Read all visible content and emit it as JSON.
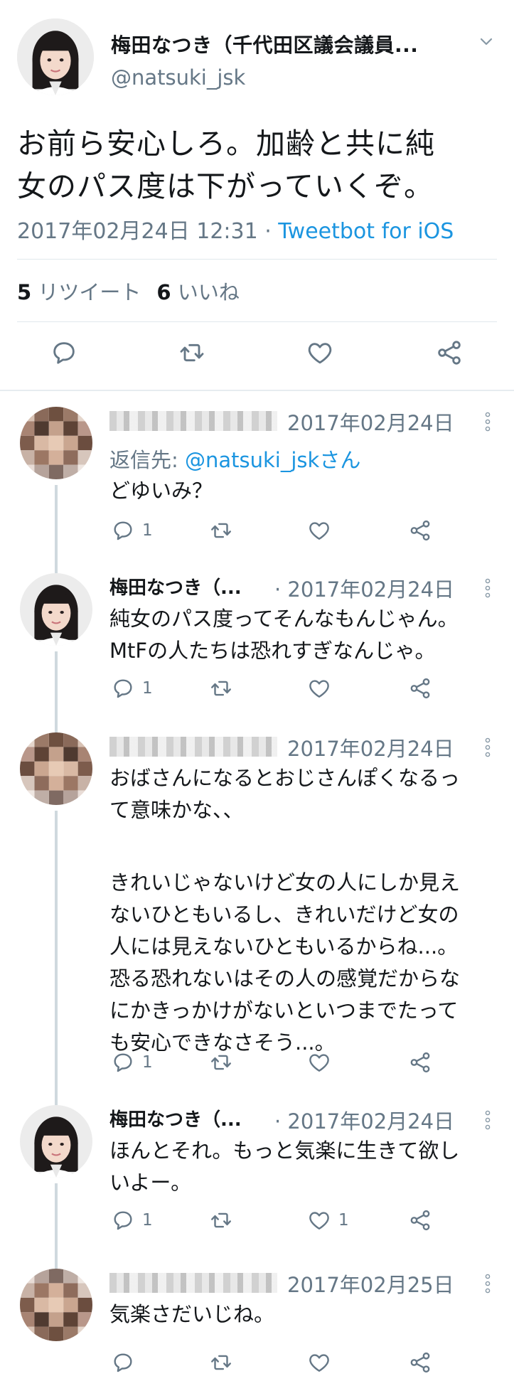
{
  "main_tweet": {
    "name": "梅田なつき（千代田区議会議員...",
    "handle": "@natsuki_jsk",
    "text_line1": "お前ら安心しろ。加齢と共に純",
    "text_line2": "女のパス度は下がっていくぞ。",
    "timestamp": "2017年02月24日 12:31",
    "separator": " · ",
    "source": "Tweetbot for iOS",
    "retweet_count": "5",
    "retweet_label": "リツイート",
    "like_count": "6",
    "like_label": "いいね"
  },
  "replies": [
    {
      "name": "",
      "time": "2017年02月24日",
      "reply_to_label": "返信先: ",
      "reply_to_handle": "@natsuki_jskさん",
      "lines": [
        "どゆいみ？"
      ],
      "reply_count": "1",
      "retweet_count": "",
      "like_count": ""
    },
    {
      "name": "梅田なつき（...",
      "time": "· 2017年02月24日",
      "lines": [
        "純女のパス度ってそんなもんじゃん。",
        "MtFの人たちは恐れすぎなんじゃ。"
      ],
      "reply_count": "1",
      "retweet_count": "",
      "like_count": ""
    },
    {
      "name": "",
      "time": "2017年02月24日",
      "lines": [
        "おばさんになるとおじさんぽくなるっ",
        "て意味かな、、",
        "",
        "きれいじゃないけど女の人にしか見え",
        "ないひともいるし、きれいだけど女の",
        "人には見えないひともいるからね...。",
        "恐る恐れないはその人の感覚だからな",
        "にかきっかけがないといつまでたって",
        "も安心できなさそう...。"
      ],
      "reply_count": "1",
      "retweet_count": "",
      "like_count": ""
    },
    {
      "name": "梅田なつき（...",
      "time": "· 2017年02月24日",
      "lines": [
        "ほんとそれ。もっと気楽に生きて欲し",
        "いよー。"
      ],
      "reply_count": "1",
      "retweet_count": "",
      "like_count": "1"
    },
    {
      "name": "",
      "time": "2017年02月25日",
      "lines": [
        "気楽さだいじね。"
      ],
      "reply_count": "",
      "retweet_count": "",
      "like_count": ""
    }
  ],
  "icons": {
    "reply": "reply-icon",
    "retweet": "retweet-icon",
    "like": "heart-icon",
    "share": "share-icon",
    "more": "more-dots-icon",
    "caret": "chevron-down-icon"
  },
  "colors": {
    "text": "#14171a",
    "secondary": "#657786",
    "link": "#1b95e0",
    "divider": "#e6ecf0"
  }
}
